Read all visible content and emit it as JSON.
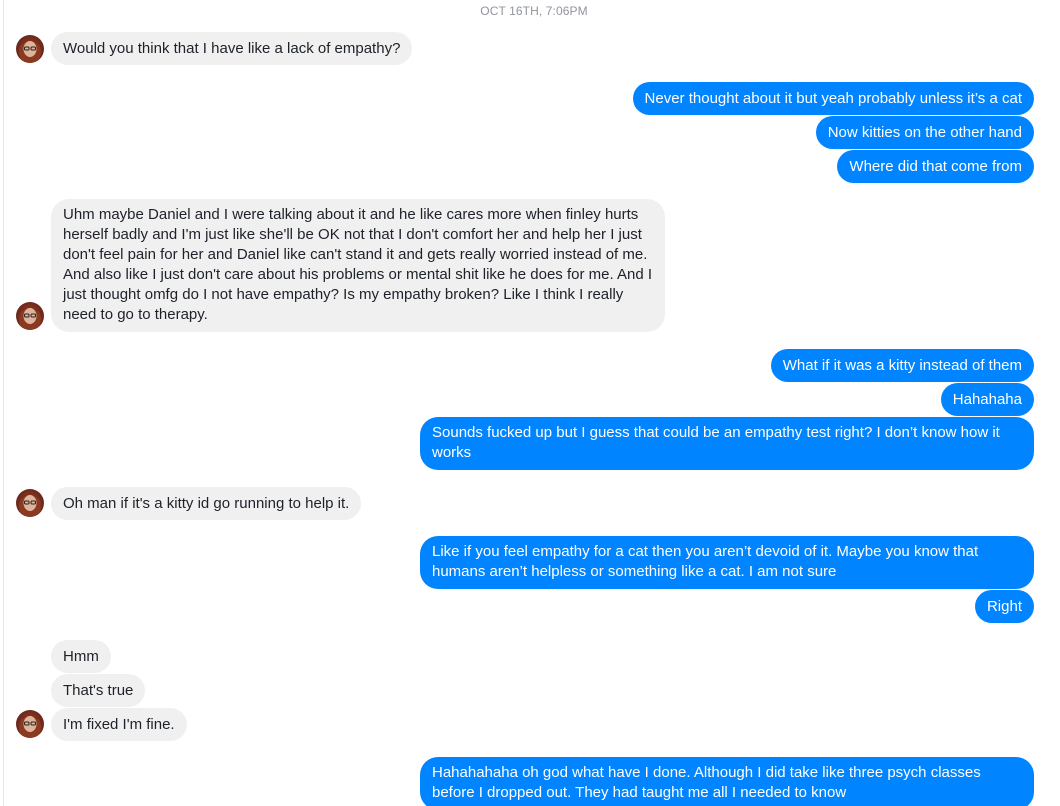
{
  "conversation": {
    "timestamp": "OCT 16TH, 7:06PM",
    "messages": [
      {
        "from": "them",
        "text": "Would you think that I have like a lack of empathy?"
      },
      {
        "from": "me",
        "text": "Never thought about it but yeah probably unless it’s a cat"
      },
      {
        "from": "me",
        "text": "Now kitties on the other hand"
      },
      {
        "from": "me",
        "text": "Where did that come from"
      },
      {
        "from": "them",
        "text": "Uhm maybe Daniel and I were talking about it and he like cares more when finley hurts herself badly and I'm just like she'll be OK not that I don't comfort her and help her I just don't feel pain for her and Daniel like can't stand it and gets really worried instead of me. And also like I just don't care about his problems or mental shit like he does for me. And I just thought omfg do I not have empathy? Is my empathy broken? Like I think I really need to go to therapy."
      },
      {
        "from": "me",
        "text": "What if it was a kitty instead of them"
      },
      {
        "from": "me",
        "text": "Hahahaha"
      },
      {
        "from": "me",
        "text": "Sounds fucked up but I guess that could be an empathy test right? I don’t know how it works"
      },
      {
        "from": "them",
        "text": "Oh man if it's a kitty id go running to help it."
      },
      {
        "from": "me",
        "text": "Like if you feel empathy for a cat then you aren’t devoid of it. Maybe you know that humans aren’t helpless or something like a cat. I am not sure"
      },
      {
        "from": "me",
        "text": "Right"
      },
      {
        "from": "them",
        "text": "Hmm"
      },
      {
        "from": "them",
        "text": "That's true"
      },
      {
        "from": "them",
        "text": "I'm fixed I'm fine."
      },
      {
        "from": "me",
        "text": "Hahahahaha oh god what have I done. Although I did take like three psych classes before I dropped out. They had taught me all I needed to know"
      }
    ]
  },
  "colors": {
    "outgoing_bubble": "#0084ff",
    "incoming_bubble": "#f1f0f0",
    "incoming_text": "#1d2129",
    "timestamp_text": "#90949c"
  },
  "icons": {
    "avatar": "contact-avatar-icon"
  }
}
